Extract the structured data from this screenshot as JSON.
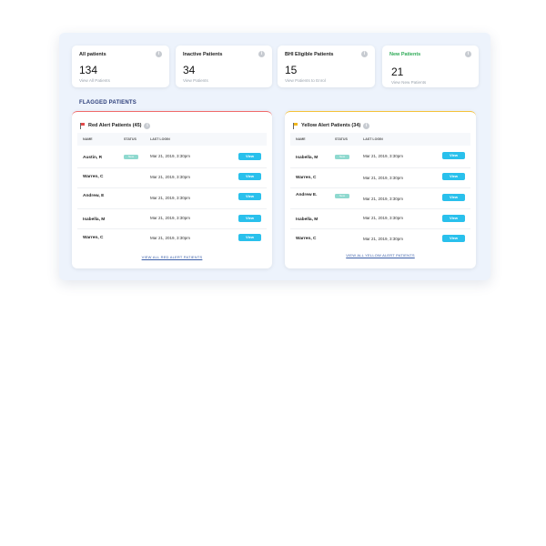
{
  "stats": [
    {
      "title": "All patients",
      "value": "134",
      "link": "View All Patients"
    },
    {
      "title": "Inactive Patients",
      "value": "34",
      "link": "View Patients"
    },
    {
      "title": "BHI Eligible Patients",
      "value": "15",
      "link": "View Patients to Enrol"
    },
    {
      "title": "New Patients",
      "value": "21",
      "link": "View New Patients"
    }
  ],
  "info_icon_glyph": "i",
  "section_title": "FLAGGED PATIENTS",
  "columns": {
    "name": "NAME",
    "status": "STATUS",
    "last_login": "LAST LOGIN"
  },
  "red": {
    "title": "Red Alert Patients (45)",
    "view_all": "VIEW ALL RED ALERT PATIENTS",
    "rows": [
      {
        "name": "Austin, R",
        "badge": "New",
        "login": "Mar 21, 2019, 3:30pm",
        "button": "View"
      },
      {
        "name": "Warren, C",
        "badge": "",
        "login": "Mar 21, 2019, 3:30pm",
        "button": "View"
      },
      {
        "name": "Andrew, E",
        "badge": "",
        "login": "Mar 21, 2019, 3:30pm",
        "button": "View"
      },
      {
        "name": "Isabella, M",
        "badge": "",
        "login": "Mar 21, 2019, 3:30pm",
        "button": "View"
      },
      {
        "name": "Warren, C",
        "badge": "",
        "login": "Mar 21, 2019, 3:30pm",
        "button": "View"
      }
    ]
  },
  "yellow": {
    "title": "Yellow Alert Patients (34)",
    "view_all": "VIEW ALL YELLOW ALERT PATIENTS",
    "rows": [
      {
        "name": "Isabella, M",
        "badge": "New",
        "login": "Mar 21, 2019, 3:30pm",
        "button": "View"
      },
      {
        "name": "Warren, C",
        "badge": "",
        "login": "Mar 21, 2019, 3:30pm",
        "button": "View"
      },
      {
        "name": "Andrew E.",
        "badge": "New",
        "login": "Mar 21, 2019, 3:30pm",
        "button": "View"
      },
      {
        "name": "Isabella, M",
        "badge": "",
        "login": "Mar 21, 2019, 3:30pm",
        "button": "View"
      },
      {
        "name": "Warren, C",
        "badge": "",
        "login": "Mar 21, 2019, 3:30pm",
        "button": "View"
      }
    ]
  },
  "colors": {
    "accent": "#29c0ec",
    "red_alert": "#f06a6a",
    "yellow_alert": "#f5c23a",
    "new_patients": "#2faa57",
    "badge": "#8fd9cf",
    "section_title": "#2c3e7a"
  }
}
